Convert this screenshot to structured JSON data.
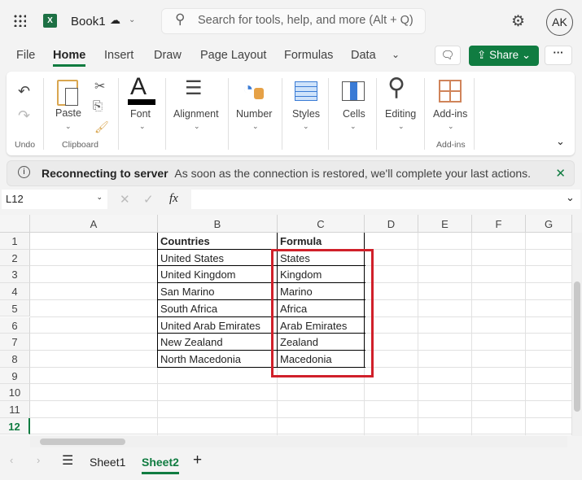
{
  "app": {
    "file_name": "Book1",
    "search_placeholder": "Search for tools, help, and more (Alt + Q)",
    "avatar": "AK"
  },
  "menu": {
    "tabs": [
      "File",
      "Home",
      "Insert",
      "Draw",
      "Page Layout",
      "Formulas",
      "Data"
    ],
    "active": "Home",
    "share": "Share"
  },
  "ribbon": {
    "paste": "Paste",
    "font": "Font",
    "alignment": "Alignment",
    "number": "Number",
    "styles": "Styles",
    "cells": "Cells",
    "editing": "Editing",
    "addins": "Add-ins",
    "groups": {
      "undo": "Undo",
      "clipboard": "Clipboard",
      "addins": "Add-ins"
    }
  },
  "banner": {
    "title": "Reconnecting to server",
    "message": "As soon as the connection is restored, we'll complete your last actions."
  },
  "formula_bar": {
    "name_box": "L12",
    "fx": "fx",
    "value": ""
  },
  "sheet": {
    "columns": [
      "A",
      "B",
      "C",
      "D",
      "E",
      "F",
      "G"
    ],
    "rows": [
      "1",
      "2",
      "3",
      "4",
      "5",
      "6",
      "7",
      "8",
      "9",
      "10",
      "11",
      "12"
    ],
    "B": [
      "Countries",
      "United States",
      "United Kingdom",
      "San Marino",
      "South Africa",
      "United Arab Emirates",
      "New Zealand",
      "North Macedonia"
    ],
    "C": [
      "Formula",
      "States",
      "Kingdom",
      "Marino",
      "Africa",
      "Arab Emirates",
      "Zealand",
      "Macedonia"
    ],
    "highlight_color": "#d0202a"
  },
  "sheet_tabs": {
    "tabs": [
      "Sheet1",
      "Sheet2"
    ],
    "active": "Sheet2",
    "add": "+"
  }
}
